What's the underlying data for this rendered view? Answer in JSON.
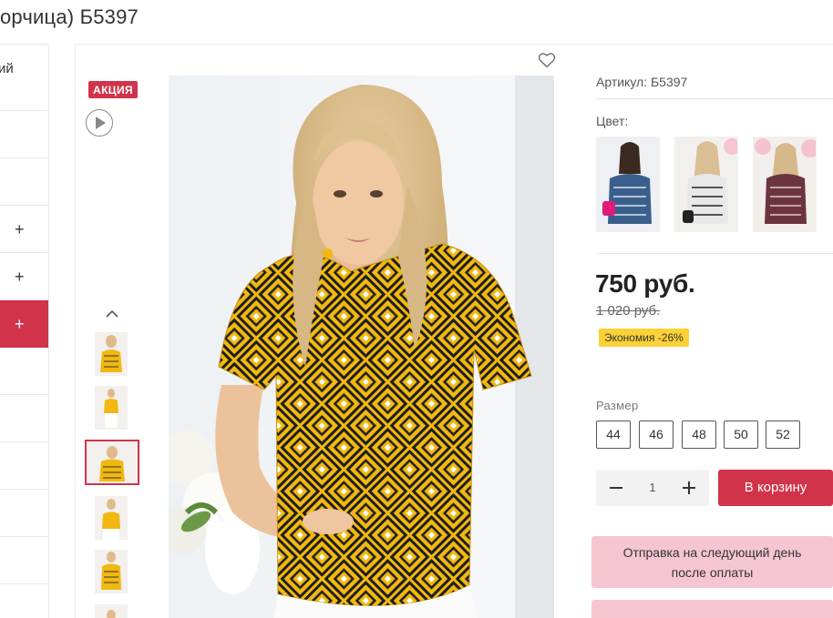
{
  "page": {
    "title": "орчица) Б5397"
  },
  "sidebar": {
    "first_item_text": "ий",
    "plus_label": "+"
  },
  "product": {
    "badge": "АКЦИЯ",
    "sku": "Артикул: Б5397",
    "color_label": "Цвет:",
    "price": "750 руб.",
    "old_price": "1 020 руб.",
    "discount": "Экономия -26%",
    "size_label": "Размер",
    "sizes": [
      "44",
      "46",
      "48",
      "50",
      "52"
    ],
    "quantity": "1",
    "add_to_cart": "В корзину",
    "shipping_note": "Отправка на следующий день после оплаты"
  },
  "colors": {
    "accent": "#d1334a",
    "discount_badge": "#fbd137",
    "shipping_box": "#f5c6d1",
    "blouse_main": "#f1b811"
  },
  "icons": {
    "favorite": "heart-outline-icon",
    "video": "play-circle-icon",
    "thumb_scroll_up": "chevron-up-icon",
    "qty_minus": "minus-icon",
    "qty_plus": "plus-icon"
  }
}
